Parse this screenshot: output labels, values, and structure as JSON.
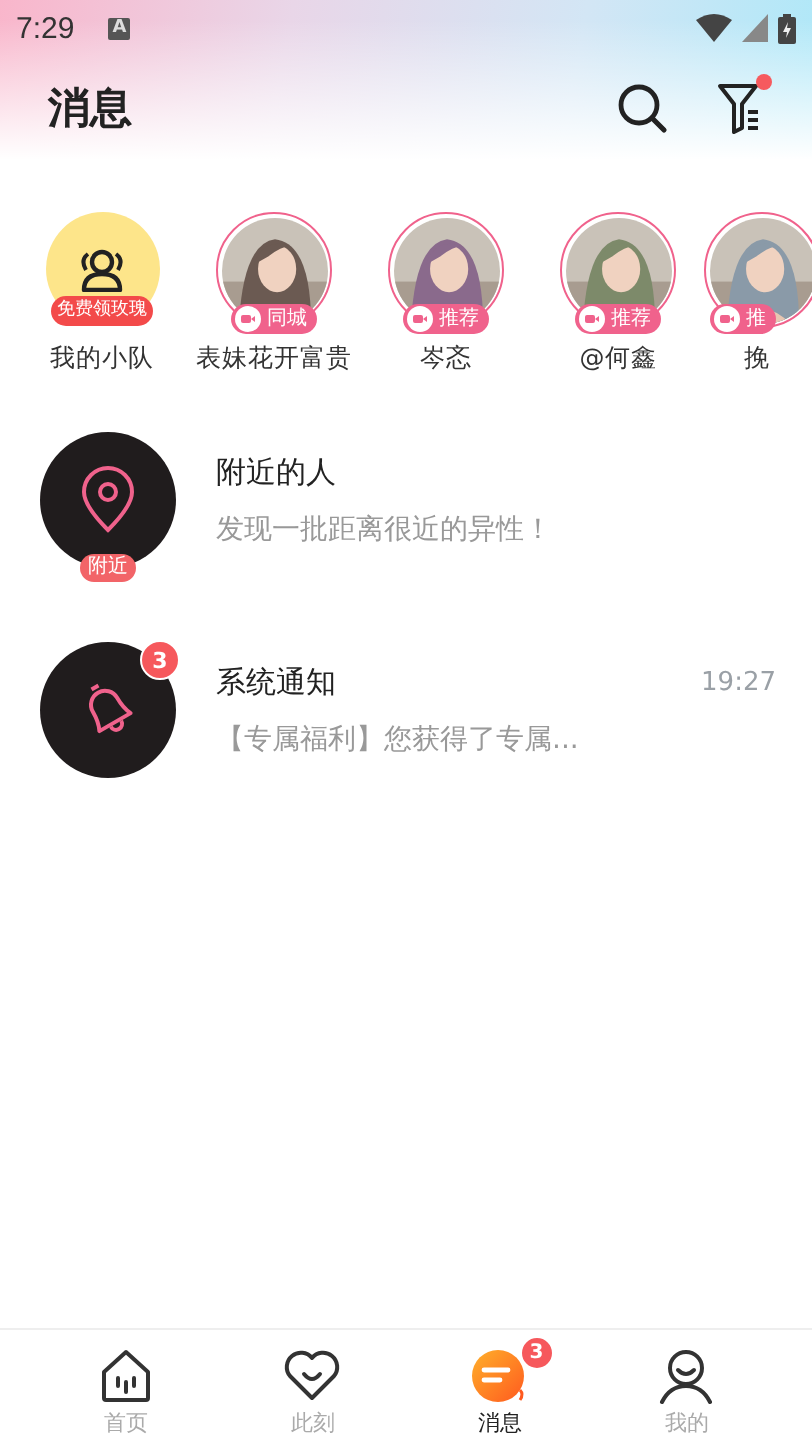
{
  "status_bar": {
    "time": "7:29",
    "notification": "A"
  },
  "header": {
    "title": "消息",
    "filter_dot": true
  },
  "stories": [
    {
      "kind": "team",
      "name": "我的小队",
      "tag": "免费领玫瑰"
    },
    {
      "kind": "person",
      "name": "表妹花开富贵",
      "tag": "同城"
    },
    {
      "kind": "person",
      "name": "岑忞",
      "tag": "推荐"
    },
    {
      "kind": "person",
      "name": "@何鑫",
      "tag": "推荐"
    },
    {
      "kind": "person",
      "name": "挽",
      "tag": "推"
    }
  ],
  "chats": [
    {
      "kind": "nearby",
      "title": "附近的人",
      "preview": "发现一批距离很近的异性！",
      "tag": "附近"
    },
    {
      "kind": "system",
      "title": "系统通知",
      "preview": "【专属福利】您获得了专属...",
      "time": "19:27",
      "badge": "3"
    }
  ],
  "tabs": [
    {
      "kind": "home",
      "label": "首页",
      "selected": false
    },
    {
      "kind": "moment",
      "label": "此刻",
      "selected": false
    },
    {
      "kind": "message",
      "label": "消息",
      "selected": true,
      "badge": "3"
    },
    {
      "kind": "me",
      "label": "我的",
      "selected": false
    }
  ]
}
